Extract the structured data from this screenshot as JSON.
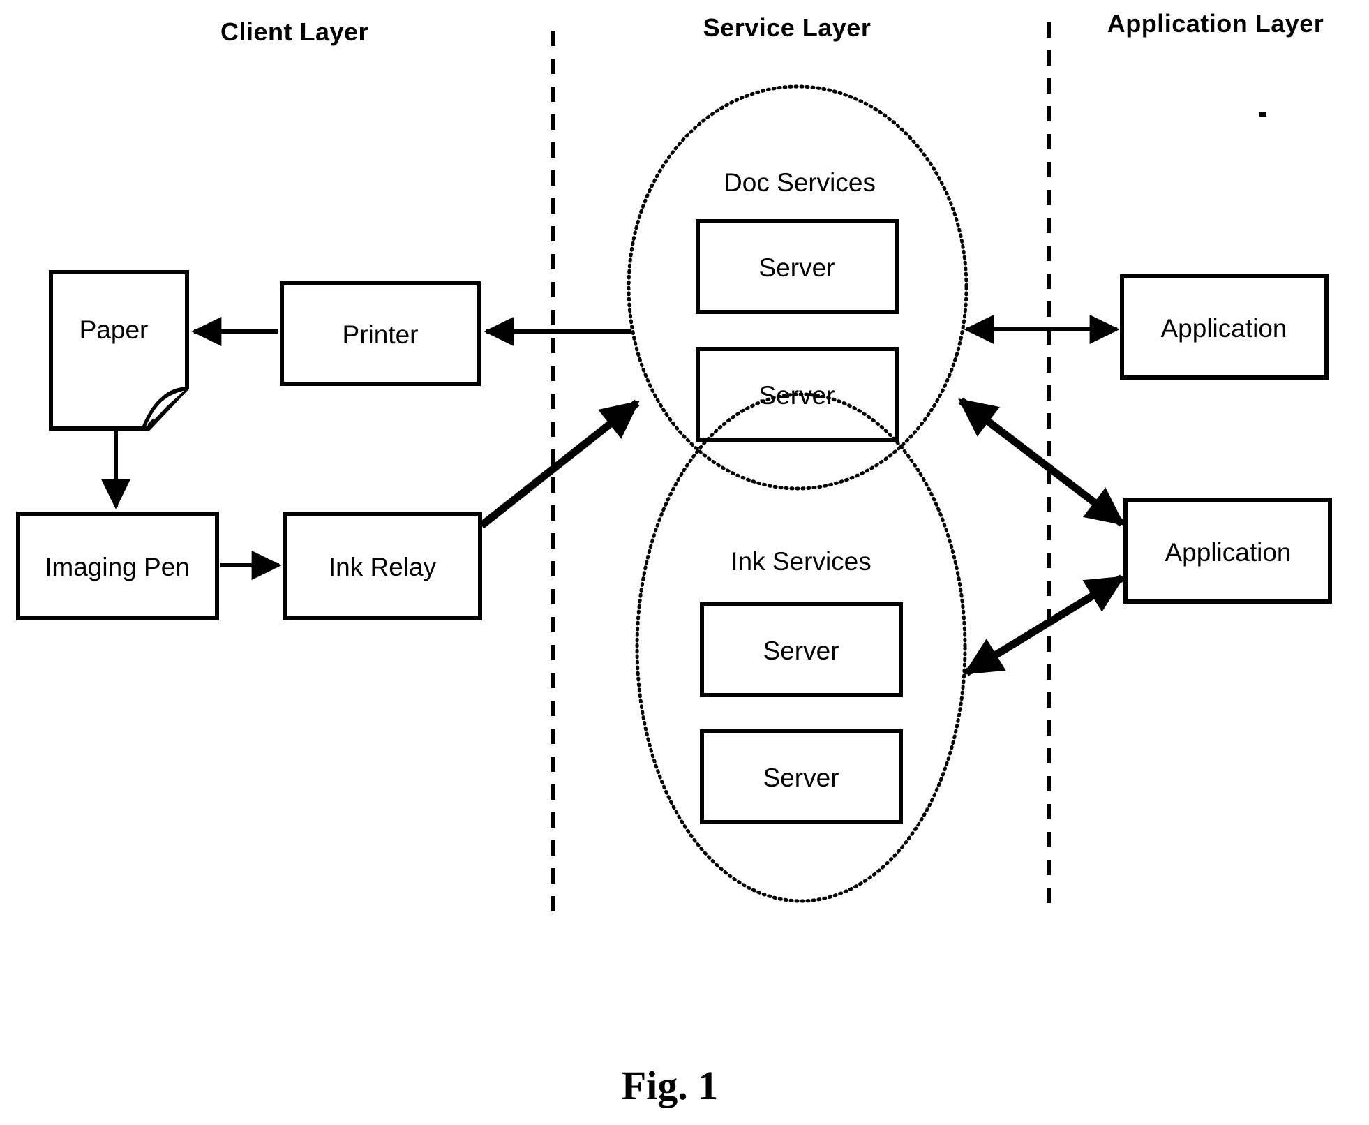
{
  "figure": {
    "caption": "Fig. 1",
    "background_color": "#ffffff",
    "ink_color": "#000000"
  },
  "layers": [
    {
      "id": "client",
      "title": "Client Layer"
    },
    {
      "id": "service",
      "title": "Service Layer"
    },
    {
      "id": "application",
      "title": "Application Layer"
    }
  ],
  "dividers": [
    {
      "id": "client-service-divider",
      "style": "dashed"
    },
    {
      "id": "service-application-divider",
      "style": "dashed"
    }
  ],
  "client_layer": {
    "nodes": [
      {
        "id": "paper",
        "label": "Paper",
        "shape": "document"
      },
      {
        "id": "printer",
        "label": "Printer",
        "shape": "rectangle"
      },
      {
        "id": "imaging-pen",
        "label": "Imaging Pen",
        "shape": "rectangle"
      },
      {
        "id": "ink-relay",
        "label": "Ink Relay",
        "shape": "rectangle"
      }
    ]
  },
  "service_layer": {
    "groups": [
      {
        "id": "doc-services",
        "label": "Doc Services",
        "shape": "dotted-ellipse",
        "servers": [
          {
            "id": "doc-server-1",
            "label": "Server"
          },
          {
            "id": "doc-server-2",
            "label": "Server"
          }
        ]
      },
      {
        "id": "ink-services",
        "label": "Ink Services",
        "shape": "dotted-ellipse",
        "servers": [
          {
            "id": "ink-server-1",
            "label": "Server"
          },
          {
            "id": "ink-server-2",
            "label": "Server"
          }
        ]
      }
    ]
  },
  "application_layer": {
    "nodes": [
      {
        "id": "application-top",
        "label": "Application",
        "shape": "rectangle"
      },
      {
        "id": "application-bottom",
        "label": "Application",
        "shape": "rectangle"
      }
    ]
  },
  "connections": [
    {
      "id": "printer-to-paper",
      "from": "printer",
      "to": "paper",
      "arrow": "single",
      "weight": "thin"
    },
    {
      "id": "paper-to-imaging-pen",
      "from": "paper",
      "to": "imaging-pen",
      "arrow": "single",
      "weight": "thin"
    },
    {
      "id": "imaging-pen-to-ink-relay",
      "from": "imaging-pen",
      "to": "ink-relay",
      "arrow": "single",
      "weight": "thin"
    },
    {
      "id": "doc-services-to-printer",
      "from": "doc-services",
      "to": "printer",
      "arrow": "single",
      "weight": "thin"
    },
    {
      "id": "ink-relay-to-doc-services",
      "from": "ink-relay",
      "to": "doc-services",
      "arrow": "single",
      "weight": "thick"
    },
    {
      "id": "doc-services-to-application-top",
      "from": "doc-services",
      "to": "application-top",
      "arrow": "double",
      "weight": "thin"
    },
    {
      "id": "doc-services-to-application-bottom",
      "from": "doc-services",
      "to": "application-bottom",
      "arrow": "double",
      "weight": "thick"
    },
    {
      "id": "ink-services-to-application-bottom",
      "from": "ink-services",
      "to": "application-bottom",
      "arrow": "double",
      "weight": "thick"
    }
  ]
}
